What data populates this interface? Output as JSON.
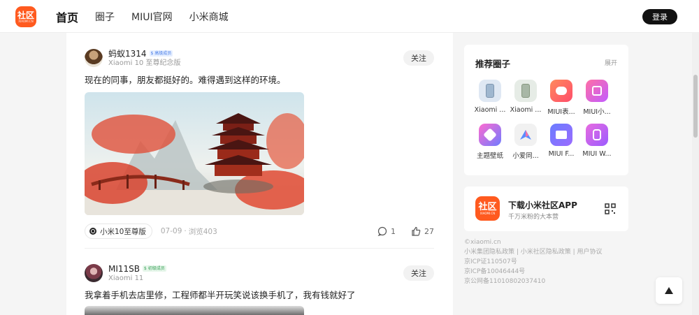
{
  "header": {
    "logo_text": "社区",
    "logo_sub": "XIAOMI.CN",
    "nav": [
      "首页",
      "圈子",
      "MIUI官网",
      "小米商城"
    ],
    "login_label": "登录"
  },
  "feed": {
    "posts": [
      {
        "author": "蚂蚁1314",
        "badge": "$ 高级成员",
        "device": "Xiaomi 10 至尊纪念版",
        "follow_label": "关注",
        "text": "现在的同事，朋友都挺好的。难得遇到这样的环境。",
        "tag": "小米10至尊版",
        "date": "07-09",
        "sep": "·",
        "views": "浏览403",
        "comments": "1",
        "likes": "27"
      },
      {
        "author": "MI11SB",
        "badge": "$ 初级成员",
        "device": "Xiaomi 11",
        "follow_label": "关注",
        "text": "我拿着手机去店里修，工程师都半开玩笑说该换手机了，我有钱就好了"
      }
    ]
  },
  "sidebar": {
    "recommend": {
      "title": "推荐圈子",
      "expand": "展开",
      "items": [
        {
          "label": "Xiaomi ...",
          "icon": "phone-blue-icon",
          "color": "#dfe8f3"
        },
        {
          "label": "Xiaomi ...",
          "icon": "phone-green-icon",
          "color": "#e6ece6"
        },
        {
          "label": "MIUI表...",
          "icon": "miui-chat-icon",
          "color": "#ff6b5a"
        },
        {
          "label": "MIUI小...",
          "icon": "miui-widget-icon",
          "color": "#ff6fa5"
        },
        {
          "label": "主题壁纸",
          "icon": "theme-icon",
          "color": "#8f6bff"
        },
        {
          "label": "小爱同...",
          "icon": "xiaoai-icon",
          "color": "#f1f1f1"
        },
        {
          "label": "MIUI F...",
          "icon": "miui-folder-icon",
          "color": "#6a7dff"
        },
        {
          "label": "MIUI W...",
          "icon": "miui-watch-icon",
          "color": "#e86be0"
        }
      ]
    },
    "app": {
      "title": "下载小米社区APP",
      "subtitle": "千万米粉的大本营",
      "logo_text": "社区",
      "logo_sub": "XIAOMI.CN"
    },
    "footer": [
      "©xiaomi.cn",
      "小米集团隐私政策 | 小米社区隐私政策 | 用户协议",
      "京ICP证110507号",
      "京ICP备10046444号",
      "京公网备11010802037410"
    ]
  }
}
